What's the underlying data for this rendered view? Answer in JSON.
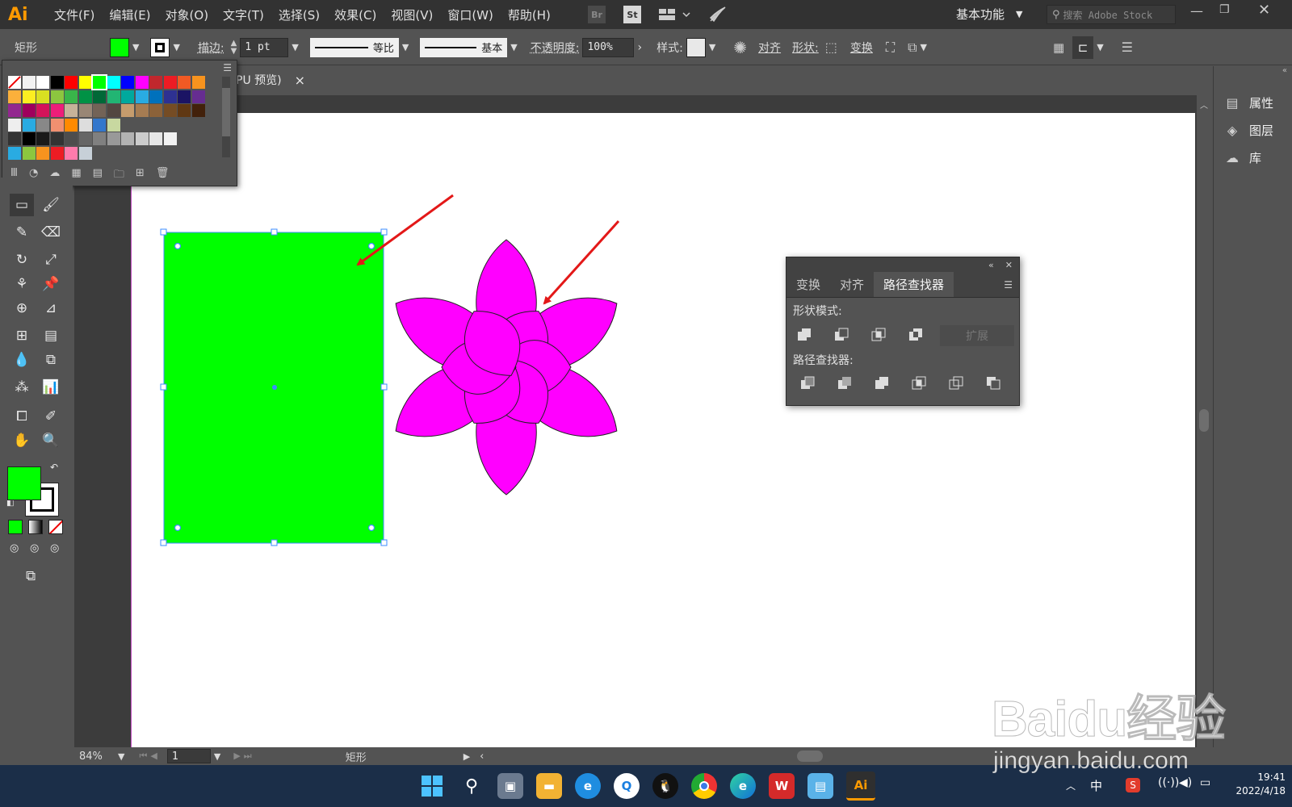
{
  "app": {
    "logo": "Ai",
    "menus": [
      "文件(F)",
      "编辑(E)",
      "对象(O)",
      "文字(T)",
      "选择(S)",
      "效果(C)",
      "视图(V)",
      "窗口(W)",
      "帮助(H)"
    ],
    "bridge_label": "Br",
    "stock_label": "St",
    "workspace": "基本功能",
    "search_placeholder": "搜索 Adobe Stock"
  },
  "control_bar": {
    "object_type": "矩形",
    "fill_color": "#00ff00",
    "stroke_label": "描边:",
    "stroke_weight": "1 pt",
    "profile_label": "等比",
    "brush_label": "基本",
    "opacity_label": "不透明度:",
    "opacity_value": "100%",
    "style_label": "样式:",
    "align_label": "对齐",
    "shape_label": "形状:",
    "transform_label": "变换"
  },
  "document_tab": {
    "title": "PU 预览)",
    "close": "×"
  },
  "right_panel": {
    "items": [
      {
        "label": "属性",
        "icon": "properties-icon"
      },
      {
        "label": "图层",
        "icon": "layers-icon"
      },
      {
        "label": "库",
        "icon": "libraries-icon"
      }
    ]
  },
  "pathfinder_panel": {
    "tabs": [
      "变换",
      "对齐",
      "路径查找器"
    ],
    "active_tab": "路径查找器",
    "shape_modes_label": "形状模式:",
    "expand_label": "扩展",
    "pathfinders_label": "路径查找器:"
  },
  "status_bar": {
    "zoom": "84%",
    "artboard_number": "1",
    "current_tool": "矩形"
  },
  "taskbar": {
    "ai_label": "Ai",
    "ime": "中",
    "time": "19:41",
    "date": "2022/4/18"
  },
  "artwork": {
    "rectangle_color": "#00ff00",
    "flower_color": "#ff00ff",
    "arrow_color": "#e31818"
  },
  "watermark": {
    "brand": "Baidu经验",
    "url": "jingyan.baidu.com"
  }
}
